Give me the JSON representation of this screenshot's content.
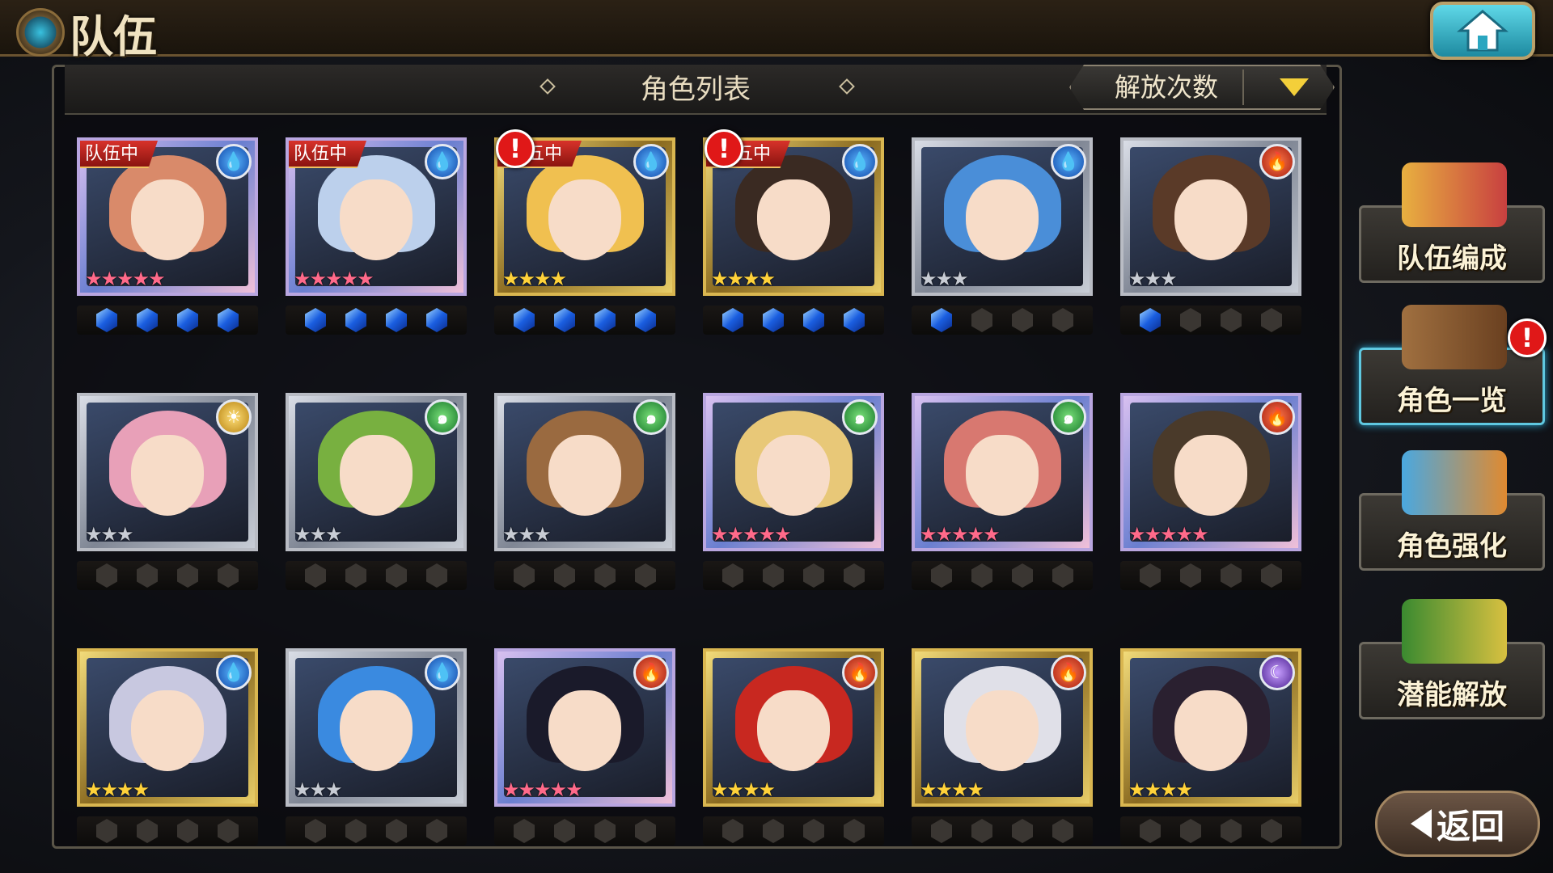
{
  "header": {
    "title": "队伍"
  },
  "panel": {
    "title": "角色列表",
    "sort_label": "解放次数"
  },
  "menu": [
    {
      "name": "team-formation",
      "label": "队伍编成",
      "active": false,
      "alert": false
    },
    {
      "name": "character-list",
      "label": "角色一览",
      "active": true,
      "alert": true
    },
    {
      "name": "character-enhance",
      "label": "角色强化",
      "active": false,
      "alert": false
    },
    {
      "name": "potential-release",
      "label": "潜能解放",
      "active": false,
      "alert": false
    }
  ],
  "back_label": "返回",
  "team_badge_text": "队伍中",
  "team_badge_text_short": "五中",
  "alert_glyph": "!",
  "characters": [
    {
      "frame": "rainbow",
      "element": "water",
      "stars": 5,
      "badge": "队伍中",
      "alert": false,
      "gems": 4,
      "hair": "#d98a6a"
    },
    {
      "frame": "rainbow",
      "element": "water",
      "stars": 5,
      "badge": "队伍中",
      "alert": false,
      "gems": 4,
      "hair": "#bcd0ec"
    },
    {
      "frame": "gold",
      "element": "water",
      "stars": 4,
      "badge": "五中",
      "alert": true,
      "gems": 4,
      "hair": "#f0c050"
    },
    {
      "frame": "gold",
      "element": "water",
      "stars": 4,
      "badge": "五中",
      "alert": true,
      "gems": 4,
      "hair": "#3a2a22"
    },
    {
      "frame": "silver",
      "element": "water",
      "stars": 3,
      "badge": "",
      "alert": false,
      "gems": 1,
      "hair": "#4a8ed8"
    },
    {
      "frame": "silver",
      "element": "fire",
      "stars": 3,
      "badge": "",
      "alert": false,
      "gems": 1,
      "hair": "#5a3a28"
    },
    {
      "frame": "silver",
      "element": "light",
      "stars": 3,
      "badge": "",
      "alert": false,
      "gems": 0,
      "hair": "#e8a0b8"
    },
    {
      "frame": "silver",
      "element": "wind",
      "stars": 3,
      "badge": "",
      "alert": false,
      "gems": 0,
      "hair": "#78b040"
    },
    {
      "frame": "silver",
      "element": "wind",
      "stars": 3,
      "badge": "",
      "alert": false,
      "gems": 0,
      "hair": "#9a6a40"
    },
    {
      "frame": "rainbow",
      "element": "wind",
      "stars": 5,
      "badge": "",
      "alert": false,
      "gems": 0,
      "hair": "#e8c878"
    },
    {
      "frame": "rainbow",
      "element": "wind",
      "stars": 5,
      "badge": "",
      "alert": false,
      "gems": 0,
      "hair": "#d87870"
    },
    {
      "frame": "rainbow",
      "element": "fire",
      "stars": 5,
      "badge": "",
      "alert": false,
      "gems": 0,
      "hair": "#4a3a2a"
    },
    {
      "frame": "gold",
      "element": "water",
      "stars": 4,
      "badge": "",
      "alert": false,
      "gems": 0,
      "hair": "#c8c8e0"
    },
    {
      "frame": "silver",
      "element": "water",
      "stars": 3,
      "badge": "",
      "alert": false,
      "gems": 0,
      "hair": "#3a8ae0"
    },
    {
      "frame": "rainbow",
      "element": "fire",
      "stars": 5,
      "badge": "",
      "alert": false,
      "gems": 0,
      "hair": "#1a1a2a"
    },
    {
      "frame": "gold",
      "element": "fire",
      "stars": 4,
      "badge": "",
      "alert": false,
      "gems": 0,
      "hair": "#c82820"
    },
    {
      "frame": "gold",
      "element": "fire",
      "stars": 4,
      "badge": "",
      "alert": false,
      "gems": 0,
      "hair": "#e0e0e8"
    },
    {
      "frame": "gold",
      "element": "dark",
      "stars": 4,
      "badge": "",
      "alert": false,
      "gems": 0,
      "hair": "#2a2030"
    }
  ],
  "element_glyphs": {
    "water": "💧",
    "fire": "🔥",
    "wind": "๑",
    "light": "☀",
    "dark": "☾"
  },
  "star_colors": {
    "rainbow": "#ff6a8a",
    "gold": "#ffd23a",
    "silver": "#c8ccd4"
  }
}
